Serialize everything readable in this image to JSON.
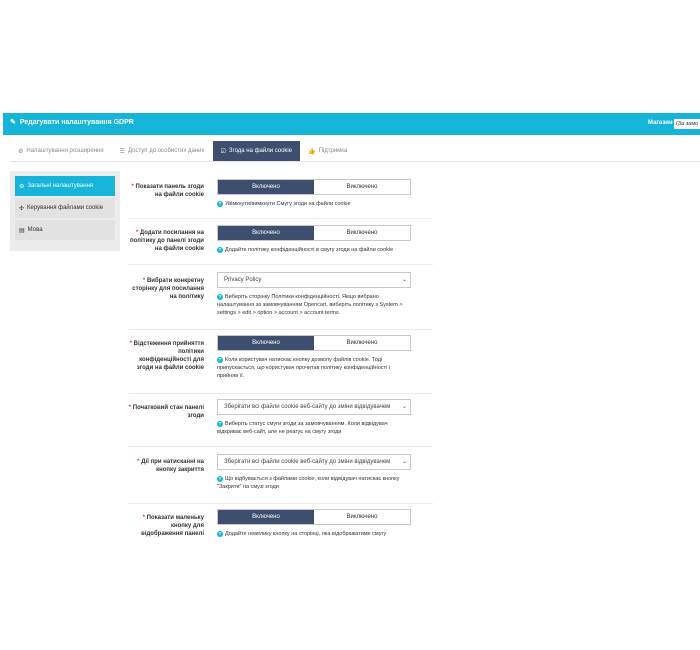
{
  "header": {
    "title": "Редагувати налаштування GDPR",
    "store_label": "Магазин",
    "store_value": "(За замо"
  },
  "tabs": [
    {
      "label": "Налаштування розширення",
      "icon": "cogs-icon",
      "active": false
    },
    {
      "label": "Доступ до особистих даних",
      "icon": "list-icon",
      "active": false
    },
    {
      "label": "Згода на файли cookie",
      "icon": "checkbox-icon",
      "active": true
    },
    {
      "label": "Підтримка",
      "icon": "thumbs-up-icon",
      "active": false
    }
  ],
  "sidebar": {
    "items": [
      {
        "label": "Загальні налаштування",
        "icon": "cogs-icon",
        "active": true
      },
      {
        "label": "Керування файлами cookie",
        "icon": "puzzle-icon",
        "active": false
      },
      {
        "label": "Мова",
        "icon": "book-icon",
        "active": false
      }
    ]
  },
  "form": {
    "on_label": "Включено",
    "off_label": "Виключено",
    "rows": [
      {
        "required": "*",
        "label": "Показати панель згоди на файли cookie",
        "type": "toggle",
        "value": "Включено",
        "help": "Увімкнути/вимкнути Смугу згоди на файли cookie"
      },
      {
        "required": "*",
        "label": "Додати посилання на політику до панелі згоди на файли cookie",
        "type": "toggle",
        "value": "Включено",
        "help": "Додайте політику конфіденційності в смугу згоди на файли cookie"
      },
      {
        "required": "*",
        "label": "Вибрати конкретну сторінку для посилання на політику",
        "type": "select",
        "value": "Privacy Policy",
        "help": "Виберіть сторінку Політики конфіденційності. Якщо вибрано налаштування за замовчуванням Opencart, виберіть політику з System > settings > edit > option > account > account terms."
      },
      {
        "required": "*",
        "label": "Відстеження прийняття політики конфіденційності для згоди на файли cookie",
        "type": "toggle",
        "value": "Включено",
        "help": "Коли користувач натискає кнопку дозволу файлів cookie. Тоді припускається, що користувач прочитав політику конфіденційності і прийняв її."
      },
      {
        "required": "*",
        "label": "Початковий стан панелі згоди",
        "type": "select",
        "value": "Зберігати всі файли cookie веб-сайту до зміни відвідувачем",
        "help": "Виберіть статус смуги згоди за замовчуванням. Коли відвідувач відкриває веб-сайт, але не реагує на смугу згоди"
      },
      {
        "required": "*",
        "label": "Дії при натисканні на кнопку закриття",
        "type": "select",
        "value": "Зберігати всі файли cookie веб-сайту до зміни відвідувачем",
        "help": "Що відбувається з файлами cookie, коли відвідувач натискає кнопку \"Закрити\" на смузі згоди"
      },
      {
        "required": "*",
        "label": "Показати маленьку кнопку для відображення панелі",
        "type": "toggle",
        "value": "Включено",
        "help": "Додайте невелику кнопку на сторінці, яка відображатиме смугу"
      }
    ]
  }
}
